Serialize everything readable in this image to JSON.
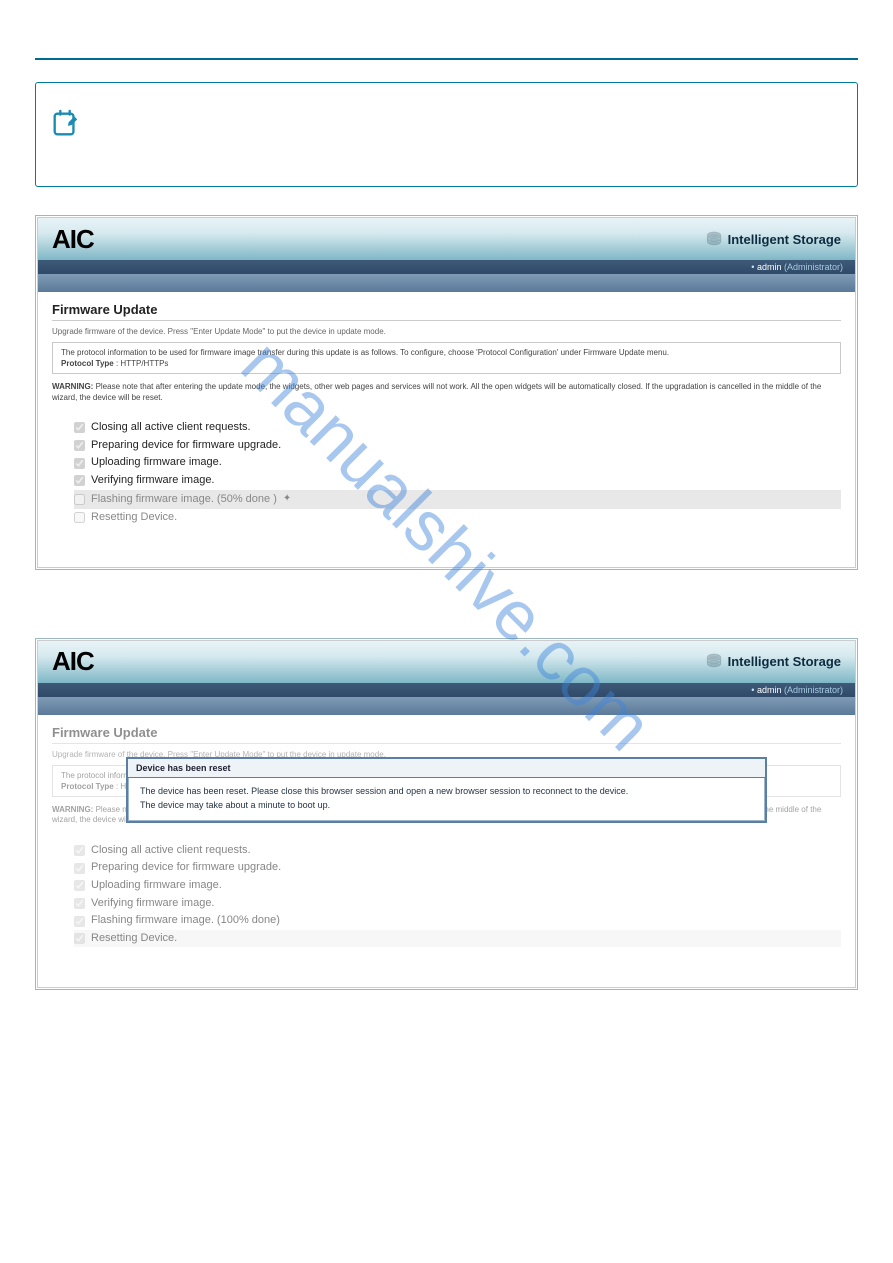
{
  "watermark": "manualshive.com",
  "shot_common": {
    "logo": "AIC",
    "brand": "Intelligent Storage",
    "user_prefix": "• ",
    "user": "admin",
    "role": "(Administrator)",
    "title": "Firmware Update",
    "subtitle": "Upgrade firmware of the device. Press \"Enter Update Mode\" to put the device in update mode.",
    "proto_line1": "The protocol information to be used for firmware image transfer during this update is as follows. To configure, choose 'Protocol Configuration' under Firmware Update menu.",
    "proto_label": "Protocol Type",
    "proto_value": ": HTTP/HTTPs",
    "warn_label": "WARNING:",
    "warn_text": "Please note that after entering the update mode, the widgets, other web pages and services will not work. All the open widgets will be automatically closed. If the upgradation is cancelled in the middle of the wizard, the device will be reset."
  },
  "shot1": {
    "steps": [
      {
        "label": "Closing all active client requests.",
        "done": true
      },
      {
        "label": "Preparing device for firmware upgrade.",
        "done": true
      },
      {
        "label": "Uploading firmware image.",
        "done": true
      },
      {
        "label": "Verifying firmware image.",
        "done": true
      },
      {
        "label": "Flashing firmware image. (50% done )",
        "done": false,
        "busy": true
      },
      {
        "label": "Resetting Device.",
        "done": false
      }
    ]
  },
  "shot2": {
    "dialog_title": "Device has been reset",
    "dialog_line1": "The device has been reset. Please close this browser session and open a new browser session to reconnect to the device.",
    "dialog_line2": "The device may take about a minute to boot up.",
    "steps": [
      {
        "label": "Closing all active client requests."
      },
      {
        "label": "Preparing device for firmware upgrade."
      },
      {
        "label": "Uploading firmware image."
      },
      {
        "label": "Verifying firmware image."
      },
      {
        "label": "Flashing firmware image. (100% done)"
      },
      {
        "label": "Resetting Device."
      }
    ]
  }
}
